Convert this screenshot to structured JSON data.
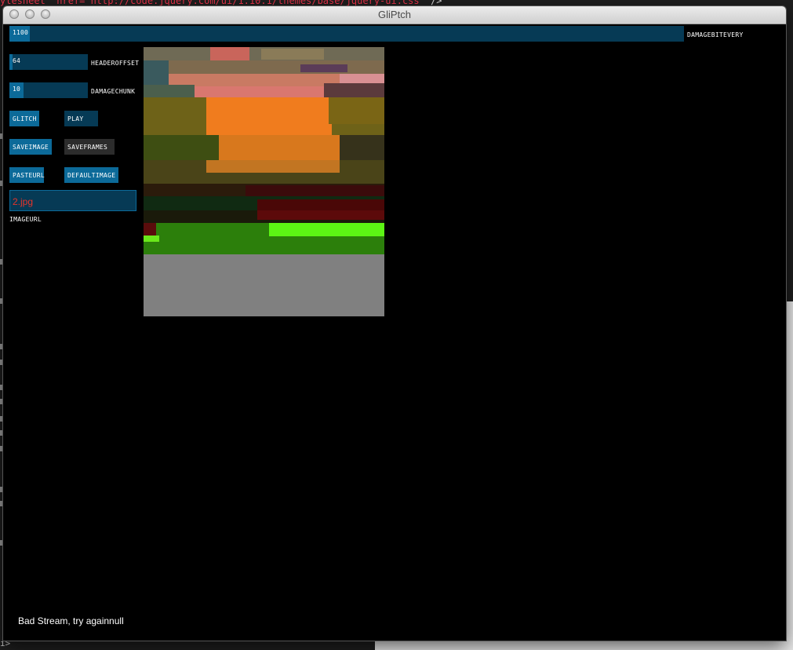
{
  "background": {
    "code_snippet_prefix": "ylesheet\" href=",
    "code_snippet_url": "\"http://code.jquery.com/ui/1.10.1/themes/base/jquery-ui.css\"",
    "code_snippet_suffix": " />",
    "bottom_text": "i>"
  },
  "window": {
    "title": "GliPtch"
  },
  "controls": {
    "damage_bit_every": {
      "value": "1100",
      "label": "DAMAGEBITEVERY",
      "fill_fraction": 0.03
    },
    "header_offset": {
      "value": "64",
      "label": "HEADEROFFSET",
      "fill_fraction": 0.04
    },
    "damage_chunk": {
      "value": "10",
      "label": "DAMAGECHUNK",
      "fill_fraction": 0.18
    },
    "buttons": {
      "glitch": "GLITCH",
      "play": "PLAY",
      "save_image": "SAVEIMAGE",
      "save_frames": "SAVEFRAMES",
      "paste_url": "PASTEURL",
      "default_image": "DEFAULTIMAGE"
    },
    "image_url": {
      "value": "2.jpg",
      "label": "IMAGEURL"
    }
  },
  "status": "Bad Stream, try againnull",
  "colors": {
    "control_dark": "#063a55",
    "control_active": "#0c6a99",
    "text_field_value": "#e8332a"
  }
}
